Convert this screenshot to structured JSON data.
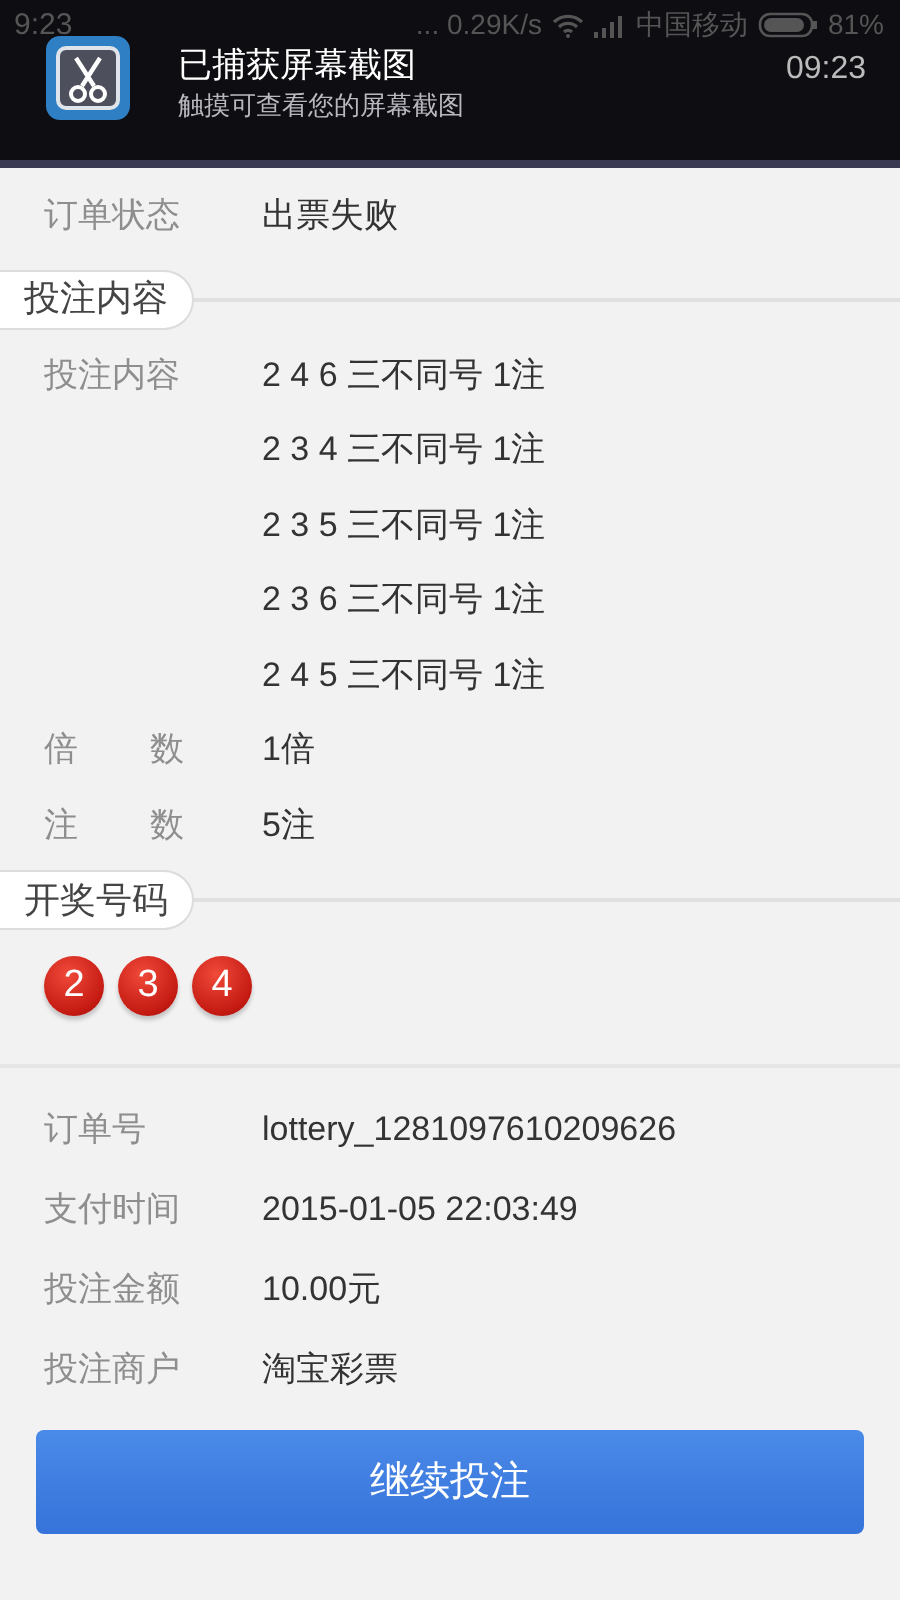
{
  "status_bar": {
    "time": "9:23",
    "speed": "... 0.29K/s",
    "carrier": "中国移动",
    "battery": "81%"
  },
  "notification": {
    "title": "已捕获屏幕截图",
    "subtitle": "触摸可查看您的屏幕截图",
    "time": "09:23"
  },
  "order_status": {
    "label": "订单状态",
    "value": "出票失败"
  },
  "bet_section": {
    "title": "投注内容",
    "label": "投注内容",
    "entries": [
      "2 4 6 三不同号 1注",
      "2 3 4 三不同号 1注",
      "2 3 5 三不同号 1注",
      "2 3 6 三不同号 1注",
      "2 4 5 三不同号 1注"
    ],
    "rows": [
      {
        "label": "倍数",
        "value": "1倍"
      },
      {
        "label": "注数",
        "value": "5注"
      }
    ]
  },
  "draw_section": {
    "title": "开奖号码",
    "balls": [
      "2",
      "3",
      "4"
    ]
  },
  "details": [
    {
      "label": "订单号",
      "value": "lottery_1281097610209626"
    },
    {
      "label": "支付时间",
      "value": "2015-01-05 22:03:49"
    },
    {
      "label": "投注金额",
      "value": "10.00元"
    },
    {
      "label": "投注商户",
      "value": "淘宝彩票"
    }
  ],
  "button": "继续投注"
}
